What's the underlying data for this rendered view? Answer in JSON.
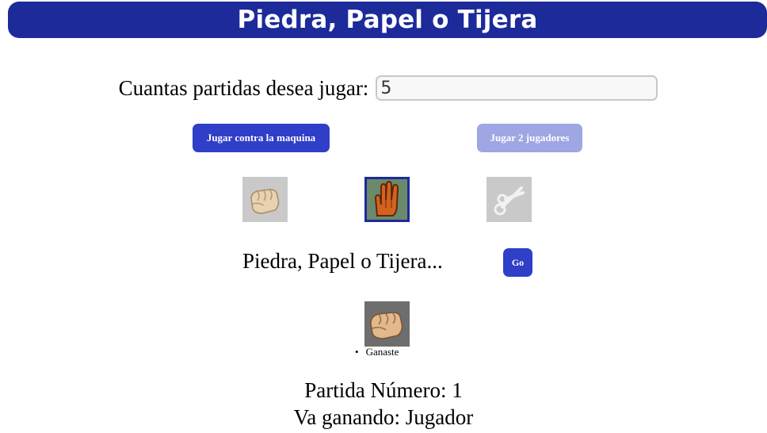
{
  "header": {
    "title": "Piedra, Papel o Tijera"
  },
  "games_field": {
    "label": "Cuantas partidas desea jugar:",
    "value": "5"
  },
  "buttons": {
    "vs_machine": "Jugar contra la maquina",
    "two_players": "Jugar 2 jugadores",
    "go": "Go"
  },
  "choices": [
    {
      "icon": "rock-fist-icon",
      "selected": false
    },
    {
      "icon": "paper-hand-icon",
      "selected": true
    },
    {
      "icon": "scissors-icon",
      "selected": false
    }
  ],
  "prompt": "Piedra, Papel o Tijera...",
  "result": {
    "icon": "rock-fist-icon",
    "text": "Ganaste"
  },
  "stats": {
    "game_number": "Partida Número: 1",
    "leader": "Va ganando: Jugador"
  },
  "colors": {
    "header_bg": "#1c2a9a",
    "primary_button": "#2f3fc8",
    "disabled_button": "#9ea6e3",
    "selected_border": "#1c2a9a"
  }
}
